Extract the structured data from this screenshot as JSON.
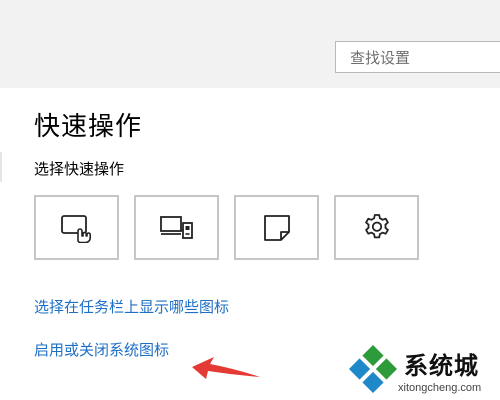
{
  "search": {
    "placeholder": "查找设置"
  },
  "page": {
    "title": "快速操作",
    "section_label": "选择快速操作"
  },
  "tiles": [
    {
      "icon": "tablet-mode-icon"
    },
    {
      "icon": "project-icon"
    },
    {
      "icon": "note-icon"
    },
    {
      "icon": "settings-gear-icon"
    }
  ],
  "links": {
    "taskbar_icons": "选择在任务栏上显示哪些图标",
    "system_icons": "启用或关闭系统图标"
  },
  "watermark": {
    "brand": "系统城",
    "url": "xitongcheng.com"
  },
  "colors": {
    "link": "#1e6fc6",
    "arrow": "#e53935",
    "tile_border": "#c6c6c6"
  }
}
